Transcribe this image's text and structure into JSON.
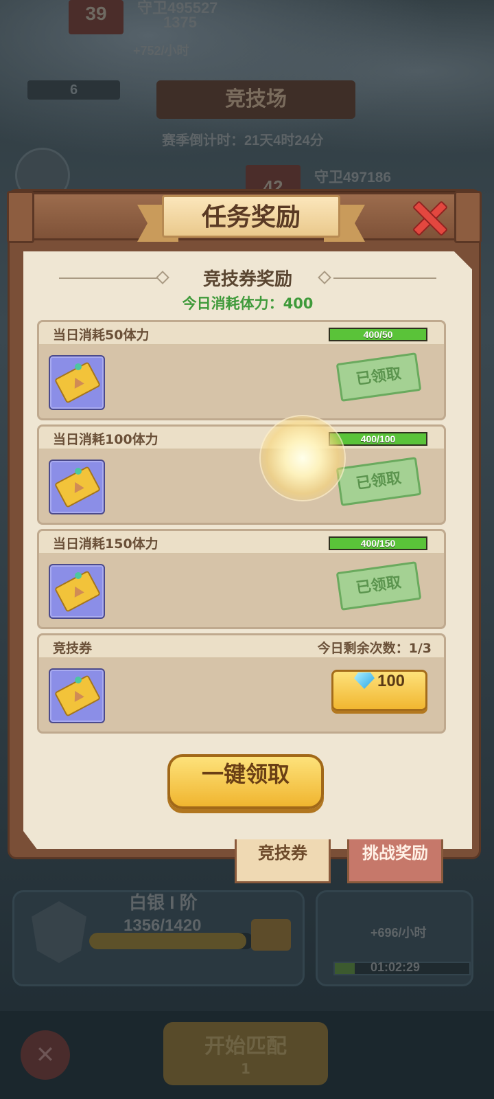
{
  "background": {
    "rank_top": "39",
    "name_top": "守卫495527",
    "power_top": "1375",
    "income_top": "+752/小时",
    "left_count": "6",
    "arena_title": "竞技场",
    "season_countdown": "赛季倒计时：21天4时24分",
    "rank_second": "42",
    "name_second": "守卫497186",
    "tier_name": "白银 I 阶",
    "tier_progress": "1356/1420",
    "tier_progress_fraction": 0.955,
    "income_bottom": "+696/小时",
    "timer": "01:02:29",
    "start_match": "开始匹配",
    "match_cost": "1"
  },
  "dialog": {
    "title": "任务奖励",
    "section_title": "竞技券奖励",
    "subtitle": "今日消耗体力：400",
    "tasks": [
      {
        "name": "当日消耗50体力",
        "progress_text": "400/50",
        "progress_fraction": 1.0,
        "status": "已领取"
      },
      {
        "name": "当日消耗100体力",
        "progress_text": "400/100",
        "progress_fraction": 1.0,
        "status": "已领取"
      },
      {
        "name": "当日消耗150体力",
        "progress_text": "400/150",
        "progress_fraction": 1.0,
        "status": "已领取"
      }
    ],
    "buy": {
      "name": "竞技券",
      "remaining": "今日剩余次数：1/3",
      "price": "100"
    },
    "claim_all": "一键领取"
  },
  "tabs": {
    "active": "竞技券",
    "inactive": "挑战奖励"
  },
  "icons": {
    "ticket": "arena-ticket-icon",
    "gem": "diamond-icon",
    "close": "close-x-icon"
  }
}
